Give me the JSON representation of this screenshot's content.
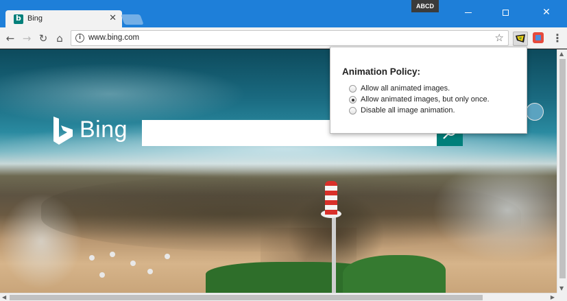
{
  "window": {
    "profile_badge": "ABCD",
    "minimize_icon": "minimize-icon",
    "maximize_icon": "maximize-icon",
    "close_glyph": "✕"
  },
  "tab": {
    "title": "Bing",
    "close_glyph": "✕",
    "favicon": "bing-favicon"
  },
  "toolbar": {
    "back_glyph": "←",
    "forward_glyph": "→",
    "reload_glyph": "↻",
    "home_glyph": "⌂",
    "url": "www.bing.com",
    "info_glyph": "i",
    "star_glyph": "☆",
    "menu_glyph": "⋮"
  },
  "page": {
    "logo_text": "Bing",
    "search_value": "",
    "search_icon": "magnifier-icon"
  },
  "popup": {
    "title": "Animation Policy:",
    "options": [
      {
        "label": "Allow all animated images.",
        "checked": false
      },
      {
        "label": "Allow animated images, but only once.",
        "checked": true
      },
      {
        "label": "Disable all image animation.",
        "checked": false
      }
    ]
  },
  "colors": {
    "titlebar": "#1e7fd9",
    "bing_teal": "#007f7a"
  }
}
